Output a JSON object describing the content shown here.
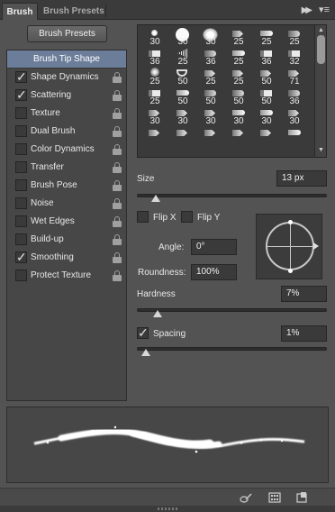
{
  "tabs": [
    {
      "label": "Brush",
      "active": true
    },
    {
      "label": "Brush Presets",
      "active": false
    }
  ],
  "preset_button": "Brush Presets",
  "options": {
    "header": "Brush Tip Shape",
    "items": [
      {
        "label": "Shape Dynamics",
        "checked": true
      },
      {
        "label": "Scattering",
        "checked": true
      },
      {
        "label": "Texture",
        "checked": false
      },
      {
        "label": "Dual Brush",
        "checked": false
      },
      {
        "label": "Color Dynamics",
        "checked": false
      },
      {
        "label": "Transfer",
        "checked": false
      },
      {
        "label": "Brush Pose",
        "checked": false
      },
      {
        "label": "Noise",
        "checked": false
      },
      {
        "label": "Wet Edges",
        "checked": false
      },
      {
        "label": "Build-up",
        "checked": false
      },
      {
        "label": "Smoothing",
        "checked": true
      },
      {
        "label": "Protect Texture",
        "checked": false
      }
    ]
  },
  "brush_grid": {
    "rows": [
      [
        {
          "icon": "dot",
          "size": "30"
        },
        {
          "icon": "circle",
          "size": "30"
        },
        {
          "icon": "soft",
          "size": "30"
        },
        {
          "icon": "chisel",
          "size": "25"
        },
        {
          "icon": "marker",
          "size": "25"
        },
        {
          "icon": "round",
          "size": "25"
        }
      ],
      [
        {
          "icon": "flat",
          "size": "36"
        },
        {
          "icon": "fan",
          "size": "25"
        },
        {
          "icon": "round",
          "size": "36"
        },
        {
          "icon": "marker",
          "size": "25"
        },
        {
          "icon": "flat",
          "size": "36"
        },
        {
          "icon": "flat",
          "size": "32"
        }
      ],
      [
        {
          "icon": "bubble",
          "size": "25"
        },
        {
          "icon": "cup",
          "size": "50"
        },
        {
          "icon": "chisel",
          "size": "25"
        },
        {
          "icon": "chisel",
          "size": "25"
        },
        {
          "icon": "chisel",
          "size": "50"
        },
        {
          "icon": "chisel",
          "size": "71"
        }
      ],
      [
        {
          "icon": "flat",
          "size": "25"
        },
        {
          "icon": "marker",
          "size": "50"
        },
        {
          "icon": "round",
          "size": "50"
        },
        {
          "icon": "round",
          "size": "50"
        },
        {
          "icon": "flat",
          "size": "50"
        },
        {
          "icon": "round",
          "size": "36"
        }
      ],
      [
        {
          "icon": "chisel",
          "size": "30"
        },
        {
          "icon": "chisel",
          "size": "30"
        },
        {
          "icon": "chisel",
          "size": "30"
        },
        {
          "icon": "marker",
          "size": "30"
        },
        {
          "icon": "marker",
          "size": "30"
        },
        {
          "icon": "chisel",
          "size": "30"
        }
      ],
      [
        {
          "icon": "chisel",
          "size": ""
        },
        {
          "icon": "chisel",
          "size": ""
        },
        {
          "icon": "chisel",
          "size": ""
        },
        {
          "icon": "chisel",
          "size": ""
        },
        {
          "icon": "chisel",
          "size": ""
        },
        {
          "icon": "marker",
          "size": ""
        }
      ]
    ]
  },
  "controls": {
    "size_label": "Size",
    "size_value": "13 px",
    "size_slider": 0.06,
    "flip_x_label": "Flip X",
    "flip_x_checked": false,
    "flip_y_label": "Flip Y",
    "flip_y_checked": false,
    "angle_label": "Angle:",
    "angle_value": "0°",
    "roundness_label": "Roundness:",
    "roundness_value": "100%",
    "hardness_label": "Hardness",
    "hardness_value": "7%",
    "hardness_slider": 0.07,
    "spacing_label": "Spacing",
    "spacing_checked": true,
    "spacing_value": "1%",
    "spacing_slider": 0.01
  },
  "colors": {
    "panel": "#535353",
    "selection": "#6c7d99",
    "field": "#3a3a3a"
  },
  "icons": [
    "collapse-icon",
    "panel-menu-icon",
    "lock-icon",
    "toggle-live-tip-icon",
    "brush-grid-icon",
    "new-brush-icon"
  ]
}
